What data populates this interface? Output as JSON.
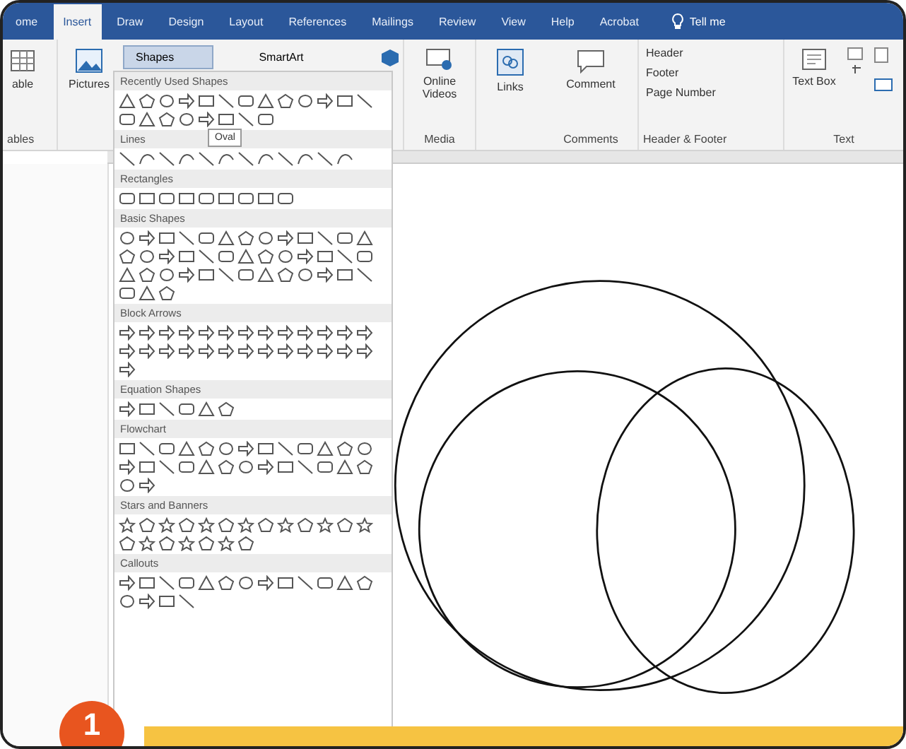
{
  "tabs": [
    {
      "label": "ome",
      "selected": false
    },
    {
      "label": "Insert",
      "selected": true
    },
    {
      "label": "Draw",
      "selected": false
    },
    {
      "label": "Design",
      "selected": false
    },
    {
      "label": "Layout",
      "selected": false
    },
    {
      "label": "References",
      "selected": false
    },
    {
      "label": "Mailings",
      "selected": false
    },
    {
      "label": "Review",
      "selected": false
    },
    {
      "label": "View",
      "selected": false
    },
    {
      "label": "Help",
      "selected": false
    },
    {
      "label": "Acrobat",
      "selected": false
    }
  ],
  "tell_me": "Tell me",
  "ribbon": {
    "table": {
      "label": "able",
      "group": "ables"
    },
    "pictures": "Pictures",
    "shapes_button": {
      "label": "Shapes",
      "expanded": true
    },
    "smartart": "SmartArt",
    "online_videos": "Online Videos",
    "media_group": "Media",
    "links": "Links",
    "comment": "Comment",
    "comments_group": "Comments",
    "header": "Header",
    "footer": "Footer",
    "page_number": "Page Number",
    "header_footer_group": "Header & Footer",
    "text_box": "Text Box",
    "text_group": "Text"
  },
  "gallery": {
    "tooltip": "Oval",
    "sections": [
      {
        "title": "Recently Used Shapes",
        "kind": "recent"
      },
      {
        "title": "Lines",
        "kind": "lines"
      },
      {
        "title": "Rectangles",
        "kind": "rect"
      },
      {
        "title": "Basic Shapes",
        "kind": "basic"
      },
      {
        "title": "Block Arrows",
        "kind": "arrows"
      },
      {
        "title": "Equation Shapes",
        "kind": "equation"
      },
      {
        "title": "Flowchart",
        "kind": "flow"
      },
      {
        "title": "Stars and Banners",
        "kind": "stars"
      },
      {
        "title": "Callouts",
        "kind": "callouts"
      }
    ]
  },
  "step_badge": "1"
}
